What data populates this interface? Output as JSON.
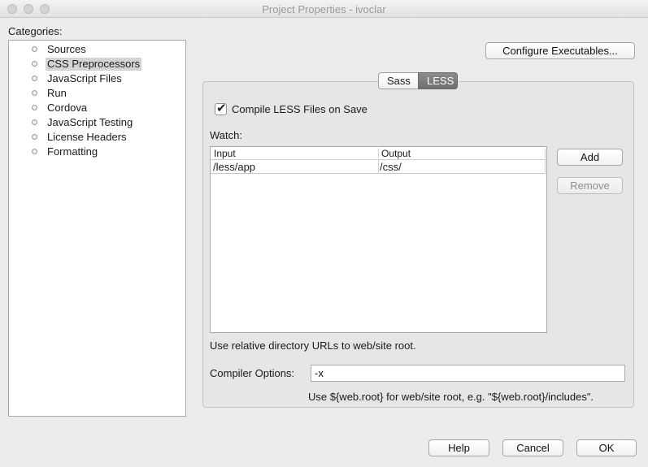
{
  "window": {
    "title": "Project Properties - ivoclar"
  },
  "categories": {
    "label": "Categories:",
    "items": [
      {
        "label": "Sources"
      },
      {
        "label": "CSS Preprocessors",
        "selected": true
      },
      {
        "label": "JavaScript Files"
      },
      {
        "label": "Run"
      },
      {
        "label": "Cordova"
      },
      {
        "label": "JavaScript Testing"
      },
      {
        "label": "License Headers"
      },
      {
        "label": "Formatting"
      }
    ]
  },
  "configure_button": {
    "label": "Configure Executables..."
  },
  "tabs": [
    {
      "label": "Sass",
      "active": false
    },
    {
      "label": "LESS",
      "active": true
    }
  ],
  "less": {
    "compile_on_save": {
      "label": "Compile LESS Files on Save",
      "checked": true
    },
    "watch_label": "Watch:",
    "table": {
      "columns": [
        "Input",
        "Output"
      ],
      "rows": [
        {
          "input": "/less/app",
          "output": "/css/"
        }
      ]
    },
    "add_button": "Add",
    "remove_button": "Remove",
    "relative_hint": "Use relative directory URLs to web/site root.",
    "compiler_options": {
      "label": "Compiler Options:",
      "value": "-x"
    },
    "root_hint": "Use ${web.root} for web/site root, e.g. \"${web.root}/includes\"."
  },
  "footer": {
    "help": "Help",
    "cancel": "Cancel",
    "ok": "OK"
  },
  "icons": {
    "checkbox": "checkmark-icon",
    "bullet": "tree-bullet-icon"
  }
}
